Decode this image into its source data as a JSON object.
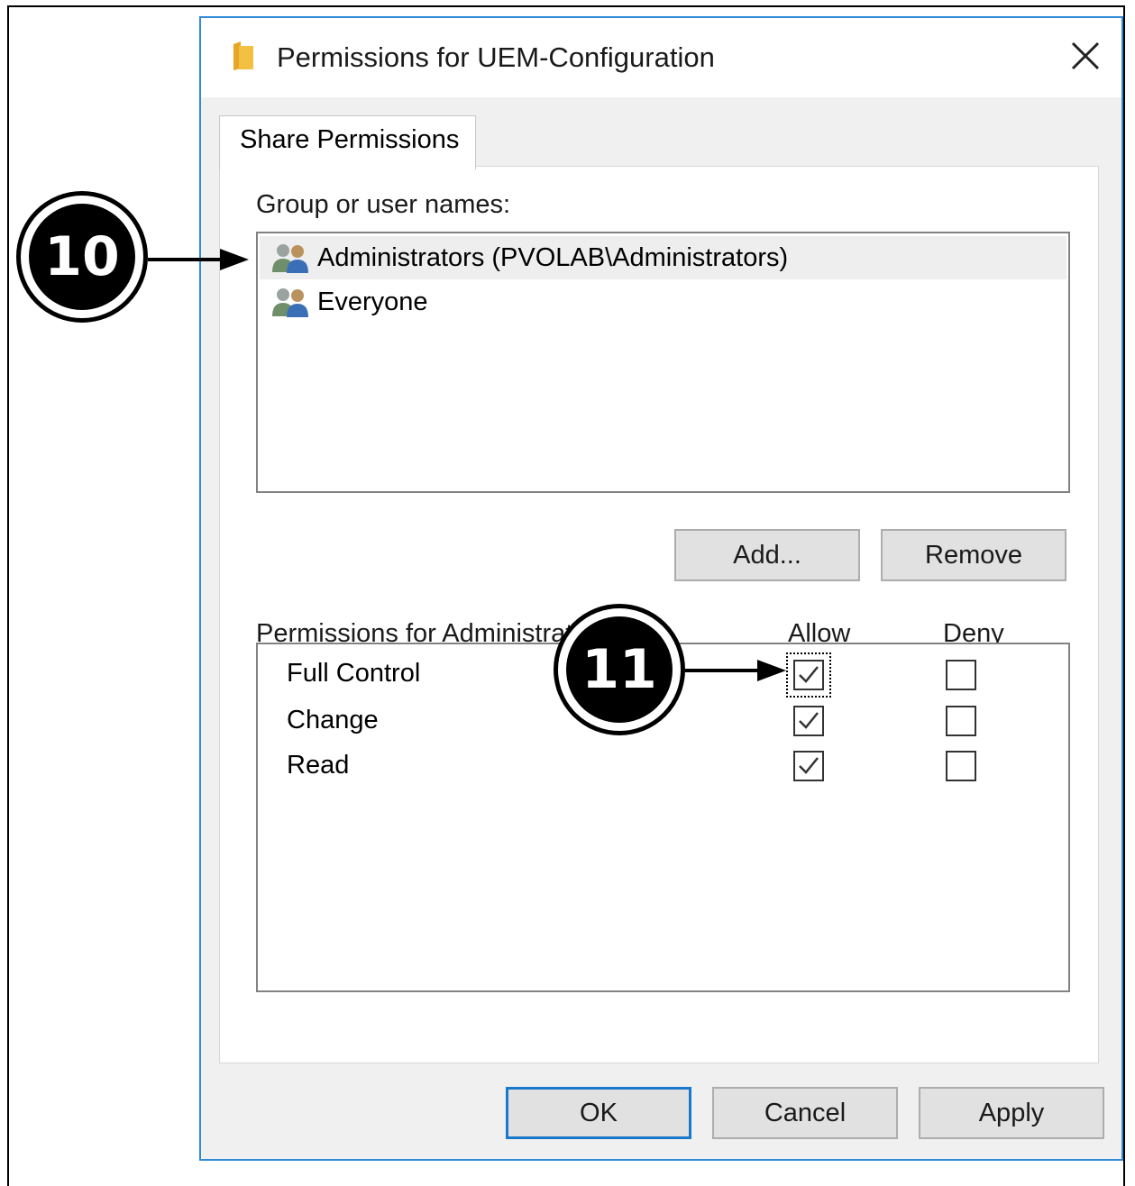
{
  "dialog": {
    "title": "Permissions for UEM-Configuration",
    "tab_label": "Share Permissions"
  },
  "groups": {
    "label": "Group or user names:",
    "items": [
      {
        "name": "Administrators (PVOLAB\\Administrators)",
        "selected": true
      },
      {
        "name": "Everyone",
        "selected": false
      }
    ],
    "add_label": "Add...",
    "remove_label": "Remove"
  },
  "permissions": {
    "label": "Permissions for Administrato",
    "allow_header": "Allow",
    "deny_header": "Deny",
    "rows": [
      {
        "name": "Full Control",
        "allow": true,
        "deny": false
      },
      {
        "name": "Change",
        "allow": true,
        "deny": false
      },
      {
        "name": "Read",
        "allow": true,
        "deny": false
      }
    ]
  },
  "footer": {
    "ok_label": "OK",
    "cancel_label": "Cancel",
    "apply_label": "Apply"
  },
  "callouts": {
    "first": "10",
    "second": "11"
  },
  "icons": {
    "folder": "folder-icon",
    "close": "close-icon",
    "users": "user-group-icon",
    "check": "checkmark-icon"
  },
  "colors": {
    "accent": "#2f8ad8",
    "ok_border": "#1979ca",
    "folder": "#f3c043"
  }
}
